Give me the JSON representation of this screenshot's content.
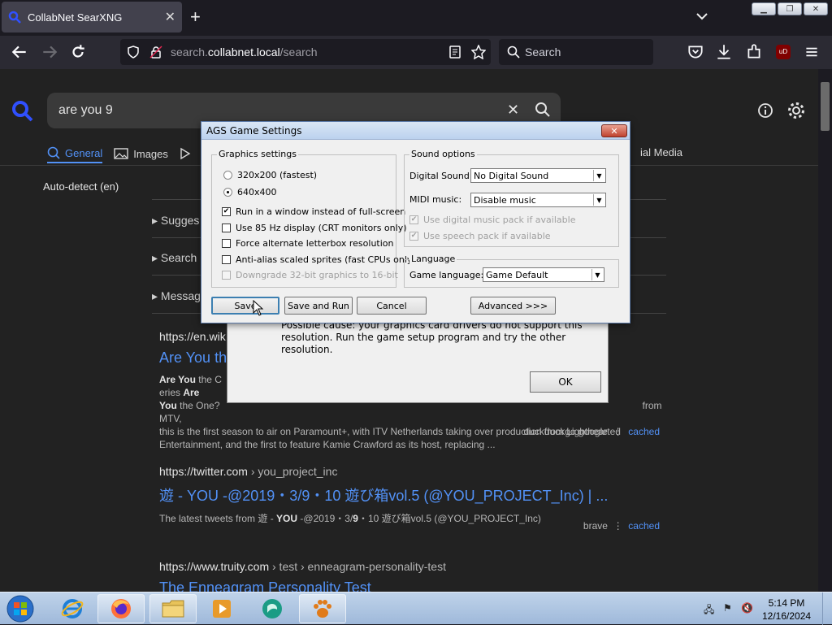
{
  "browser": {
    "tab": {
      "title": "CollabNet SearXNG",
      "close": "✕"
    },
    "new_tab": "+",
    "url": {
      "prefix": "search.",
      "domain": "collabnet.local",
      "path": "/search"
    },
    "search_placeholder": "Search",
    "ext_badge": "uD"
  },
  "searx": {
    "query": "are you 9",
    "categories": [
      {
        "label": "General",
        "active": true
      },
      {
        "label": "Images",
        "active": false
      }
    ],
    "cat_social": "ial Media",
    "language": "Auto-detect (en)",
    "expanders": [
      "Sugges",
      "Search",
      "Message"
    ],
    "results": [
      {
        "url": "https://en.wik",
        "title": "Are You th",
        "snippet_html": "<b>Are You</b> the C<span style='display:inline-block;width:540px'></span>eries <b>Are</b><br><b>You</b> the One?<span style='display:inline-block;width:520px'></span>from MTV,<br>this is the first season to air on Paramount+, with ITV Netherlands taking over production from Lighthearted<br>Entertainment, and the first to feature Kamie Crawford as its host, replacing ...",
        "engines": "duckduckgo  google",
        "cached": "cached"
      },
      {
        "url": "https://twitter.com",
        "url_path": "› you_project_inc",
        "title": "遊 - YOU -@2019・3/9・10 遊び箱vol.5 (@YOU_PROJECT_Inc) | ...",
        "snippet_html": "The latest tweets from 遊 - <b>YOU</b> -@2019・3/<b>9</b>・10 遊び箱vol.5 (@YOU_PROJECT_Inc)",
        "engines": "brave",
        "cached": "cached"
      },
      {
        "url": "https://www.truity.com",
        "url_path": "› test › enneagram-personality-test",
        "title": "The Enneagram Personality Test"
      }
    ]
  },
  "error_dialog": {
    "message": "Possible cause: your graphics card drivers do not support this resolution. Run the game setup program and try the other resolution.",
    "ok": "OK"
  },
  "ags": {
    "title": "AGS Game Settings",
    "close": "✕",
    "graphics": {
      "label": "Graphics settings",
      "res1": "320x200  (fastest)",
      "res2": "640x400",
      "opt1": "Run in a window instead of full-screen",
      "opt2": "Use 85 Hz display (CRT monitors only)",
      "opt3": "Force alternate letterbox resolution",
      "opt4": "Anti-alias scaled sprites (fast CPUs only)",
      "opt5": "Downgrade 32-bit graphics to 16-bit"
    },
    "sound": {
      "label": "Sound options",
      "digital_label": "Digital Sound:",
      "digital_value": "No Digital Sound",
      "midi_label": "MIDI music:",
      "midi_value": "Disable music",
      "pack1": "Use digital music pack if available",
      "pack2": "Use speech pack if available"
    },
    "language": {
      "label": "Language",
      "game_label": "Game language:",
      "game_value": "Game Default"
    },
    "buttons": {
      "save": "Save",
      "save_run": "Save and Run",
      "cancel": "Cancel",
      "advanced": "Advanced >>>"
    }
  },
  "taskbar": {
    "time": "5:14 PM",
    "date": "12/16/2024"
  }
}
